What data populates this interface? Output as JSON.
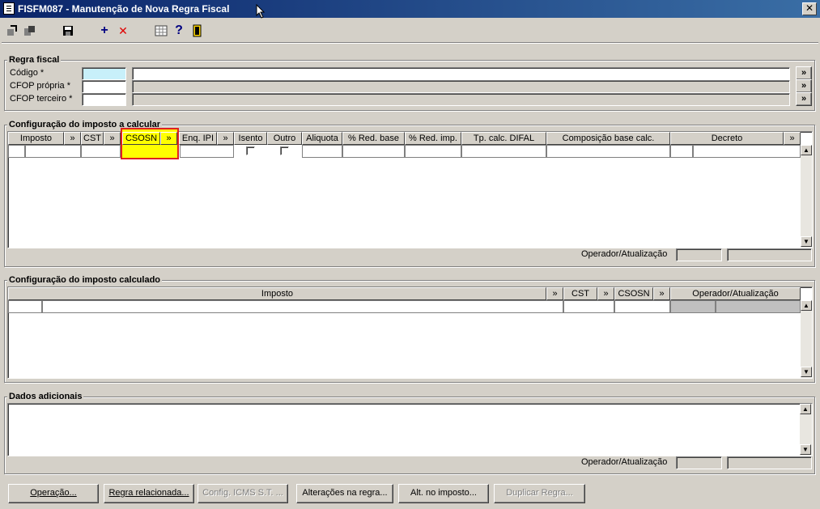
{
  "window": {
    "title": "FISFM087 - Manutenção de Nova Regra Fiscal",
    "close": "✕"
  },
  "toolbar": {
    "add": "+",
    "delete": "✕",
    "help": "?"
  },
  "regra_fiscal": {
    "legend": "Regra fiscal",
    "codigo_label": "Código *",
    "cfop_propria_label": "CFOP própria *",
    "cfop_terceiro_label": "CFOP terceiro *",
    "lookup": "»"
  },
  "config_calcular": {
    "legend": "Configuração do imposto a calcular",
    "columns": {
      "imposto": "Imposto",
      "cst": "CST",
      "csosn": "CSOSN",
      "enq_ipi": "Enq. IPI",
      "isento": "Isento",
      "outro": "Outro",
      "aliquota": "Aliquota",
      "red_base": "% Red. base",
      "red_imp": "% Red. imp.",
      "tp_calc": "Tp. calc. DIFAL",
      "composicao": "Composição base calc.",
      "decreto": "Decreto"
    },
    "lookup": "»",
    "operador_label": "Operador/Atualização"
  },
  "config_calculado": {
    "legend": "Configuração do imposto calculado",
    "columns": {
      "imposto": "Imposto",
      "cst": "CST",
      "csosn": "CSOSN",
      "operador": "Operador/Atualização"
    },
    "lookup": "»"
  },
  "dados": {
    "legend": "Dados adicionais",
    "operador_label": "Operador/Atualização"
  },
  "buttons": {
    "operacao": "Operação...",
    "regra_relacionada": "Regra relacionada...",
    "config_icms": "Config. ICMS S.T. ...",
    "alteracoes": "Alterações na regra...",
    "alt_imposto": "Alt. no imposto...",
    "duplicar": "Duplicar Regra..."
  },
  "scroll": {
    "up": "▲",
    "down": "▼"
  }
}
